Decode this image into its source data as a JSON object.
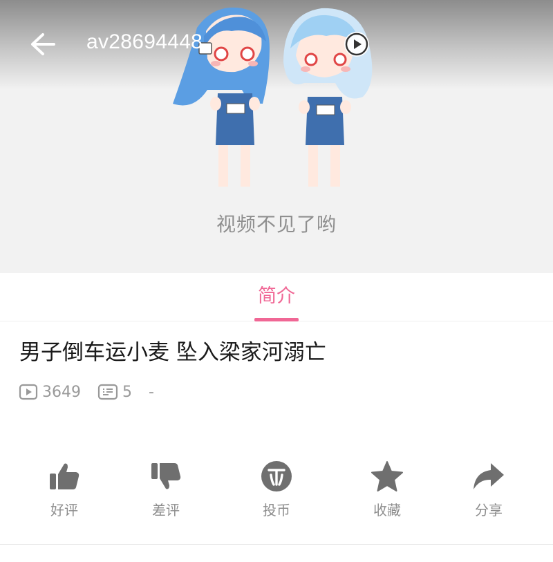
{
  "header": {
    "av_id": "av28694448",
    "back_icon": "arrow-left-icon",
    "play_icon": "play-icon"
  },
  "player": {
    "missing_message": "视频不见了哟"
  },
  "tabs": [
    {
      "label": "简介",
      "active": true
    }
  ],
  "video": {
    "title": "男子倒车运小麦 坠入梁家河溺亡",
    "views": "3649",
    "comments": "5",
    "extra": "-"
  },
  "actions": [
    {
      "label": "好评",
      "icon": "thumbs-up-icon"
    },
    {
      "label": "差评",
      "icon": "thumbs-down-icon"
    },
    {
      "label": "投币",
      "icon": "coin-icon"
    },
    {
      "label": "收藏",
      "icon": "star-icon"
    },
    {
      "label": "分享",
      "icon": "share-icon"
    }
  ],
  "colors": {
    "accent": "#f06795",
    "icon_gray": "#6f6f6f",
    "label_gray": "#8d8d8d"
  }
}
